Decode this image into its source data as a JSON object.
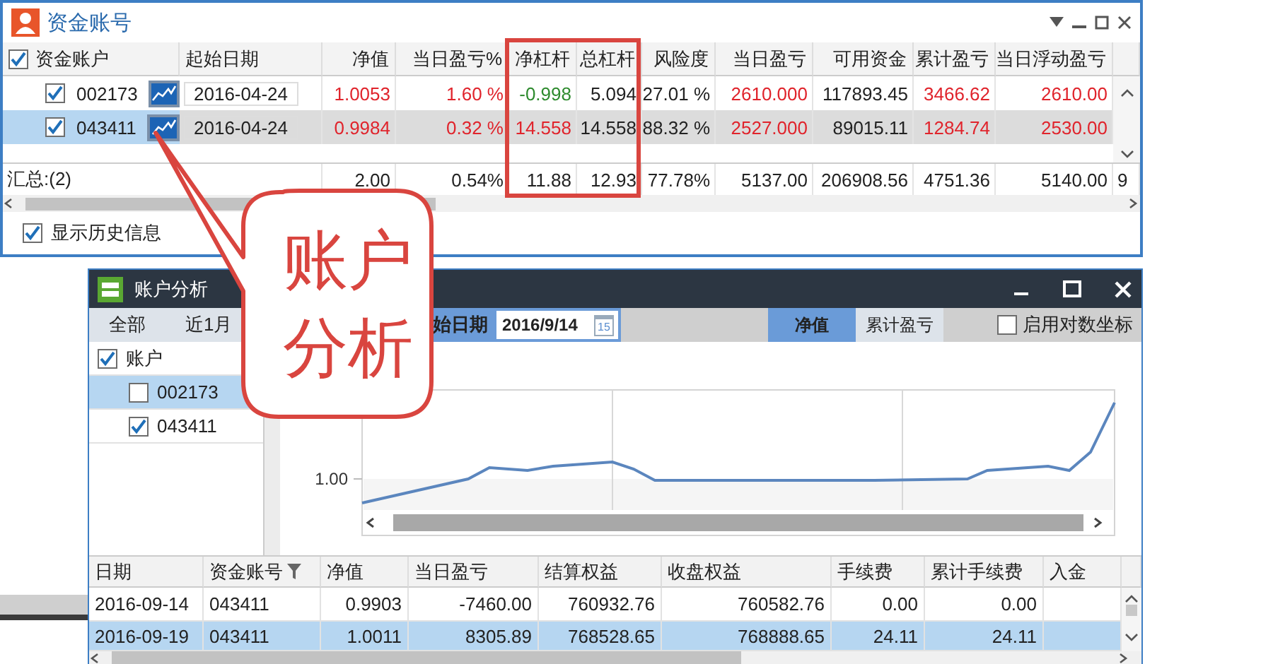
{
  "main_window": {
    "title": "资金账号",
    "header_checked": true,
    "columns": [
      "资金账户",
      "起始日期",
      "净值",
      "当日盈亏%",
      "净杠杆",
      "总杠杆",
      "风险度",
      "当日盈亏",
      "可用资金",
      "累计盈亏",
      "当日浮动盈亏"
    ],
    "rows": [
      {
        "checked": true,
        "selected": false,
        "cells": [
          {
            "kind": "account",
            "text": "002173"
          },
          {
            "kind": "date",
            "text": "2016-04-24"
          },
          {
            "kind": "value",
            "text": "1.0053",
            "color": "#e0242c"
          },
          {
            "kind": "value",
            "text": "1.60 %",
            "color": "#e0242c"
          },
          {
            "kind": "value",
            "text": "-0.998",
            "color": "#2e8b2e"
          },
          {
            "kind": "value",
            "text": "5.094",
            "color": "#222222"
          },
          {
            "kind": "value",
            "text": "27.01 %",
            "color": "#222222"
          },
          {
            "kind": "value",
            "text": "2610.000",
            "color": "#e0242c"
          },
          {
            "kind": "value",
            "text": "117893.45",
            "color": "#222222"
          },
          {
            "kind": "value",
            "text": "3466.62",
            "color": "#e0242c"
          },
          {
            "kind": "value",
            "text": "2610.00",
            "color": "#e0242c"
          }
        ]
      },
      {
        "checked": true,
        "selected": true,
        "cells": [
          {
            "kind": "account",
            "text": "043411"
          },
          {
            "kind": "date",
            "text": "2016-04-24"
          },
          {
            "kind": "value",
            "text": "0.9984",
            "color": "#e0242c"
          },
          {
            "kind": "value",
            "text": "0.32 %",
            "color": "#e0242c"
          },
          {
            "kind": "value",
            "text": "14.558",
            "color": "#e0242c"
          },
          {
            "kind": "value",
            "text": "14.558",
            "color": "#222222"
          },
          {
            "kind": "value",
            "text": "88.32 %",
            "color": "#222222"
          },
          {
            "kind": "value",
            "text": "2527.000",
            "color": "#e0242c"
          },
          {
            "kind": "value",
            "text": "89015.11",
            "color": "#222222"
          },
          {
            "kind": "value",
            "text": "1284.74",
            "color": "#e0242c"
          },
          {
            "kind": "value",
            "text": "2530.00",
            "color": "#e0242c"
          }
        ]
      }
    ],
    "total": [
      {
        "text": "汇总:(2)",
        "kind": "label"
      },
      {
        "text": "2.00"
      },
      {
        "text": "0.54%"
      },
      {
        "text": "11.88"
      },
      {
        "text": "12.93"
      },
      {
        "text": "77.78%"
      },
      {
        "text": "5137.00"
      },
      {
        "text": "206908.56"
      },
      {
        "text": "4751.36"
      },
      {
        "text": "5140.00"
      },
      {
        "text": "9"
      }
    ],
    "show_history": {
      "label": "显示历史信息",
      "checked": true
    }
  },
  "callout": {
    "lines": [
      "账户",
      "分析"
    ]
  },
  "analysis_window": {
    "title": "账户分析",
    "ranges": [
      {
        "label": "全部",
        "selected": false
      },
      {
        "label": "近1月",
        "selected": false
      }
    ],
    "start_date_label": "始日期",
    "start_date": "2016/9/14",
    "calendar_day": "15",
    "views": [
      {
        "label": "净值",
        "selected": true
      },
      {
        "label": "累计盈亏",
        "selected": false
      }
    ],
    "log_scale": {
      "label": "启用对数坐标",
      "checked": false
    },
    "tree": {
      "label": "账户",
      "checked": true,
      "children": [
        {
          "label": "002173",
          "checked": false,
          "selected": true
        },
        {
          "label": "043411",
          "checked": true,
          "selected": false
        }
      ]
    },
    "chart": {
      "y_tick": "1.00"
    },
    "table": {
      "columns": [
        {
          "label": "日期",
          "filter": false
        },
        {
          "label": "资金账号",
          "filter": true
        },
        {
          "label": "净值",
          "filter": false
        },
        {
          "label": "当日盈亏",
          "filter": false
        },
        {
          "label": "结算权益",
          "filter": false
        },
        {
          "label": "收盘权益",
          "filter": false
        },
        {
          "label": "手续费",
          "filter": false
        },
        {
          "label": "累计手续费",
          "filter": false
        },
        {
          "label": "入金",
          "filter": false
        }
      ],
      "rows": [
        {
          "selected": false,
          "cells": [
            "2016-09-14",
            "043411",
            "0.9903",
            "-7460.00",
            "760932.76",
            "760582.76",
            "0.00",
            "0.00"
          ]
        },
        {
          "selected": true,
          "cells": [
            "2016-09-19",
            "043411",
            "1.0011",
            "8305.89",
            "768528.65",
            "768888.65",
            "24.11",
            "24.11"
          ]
        }
      ]
    }
  }
}
